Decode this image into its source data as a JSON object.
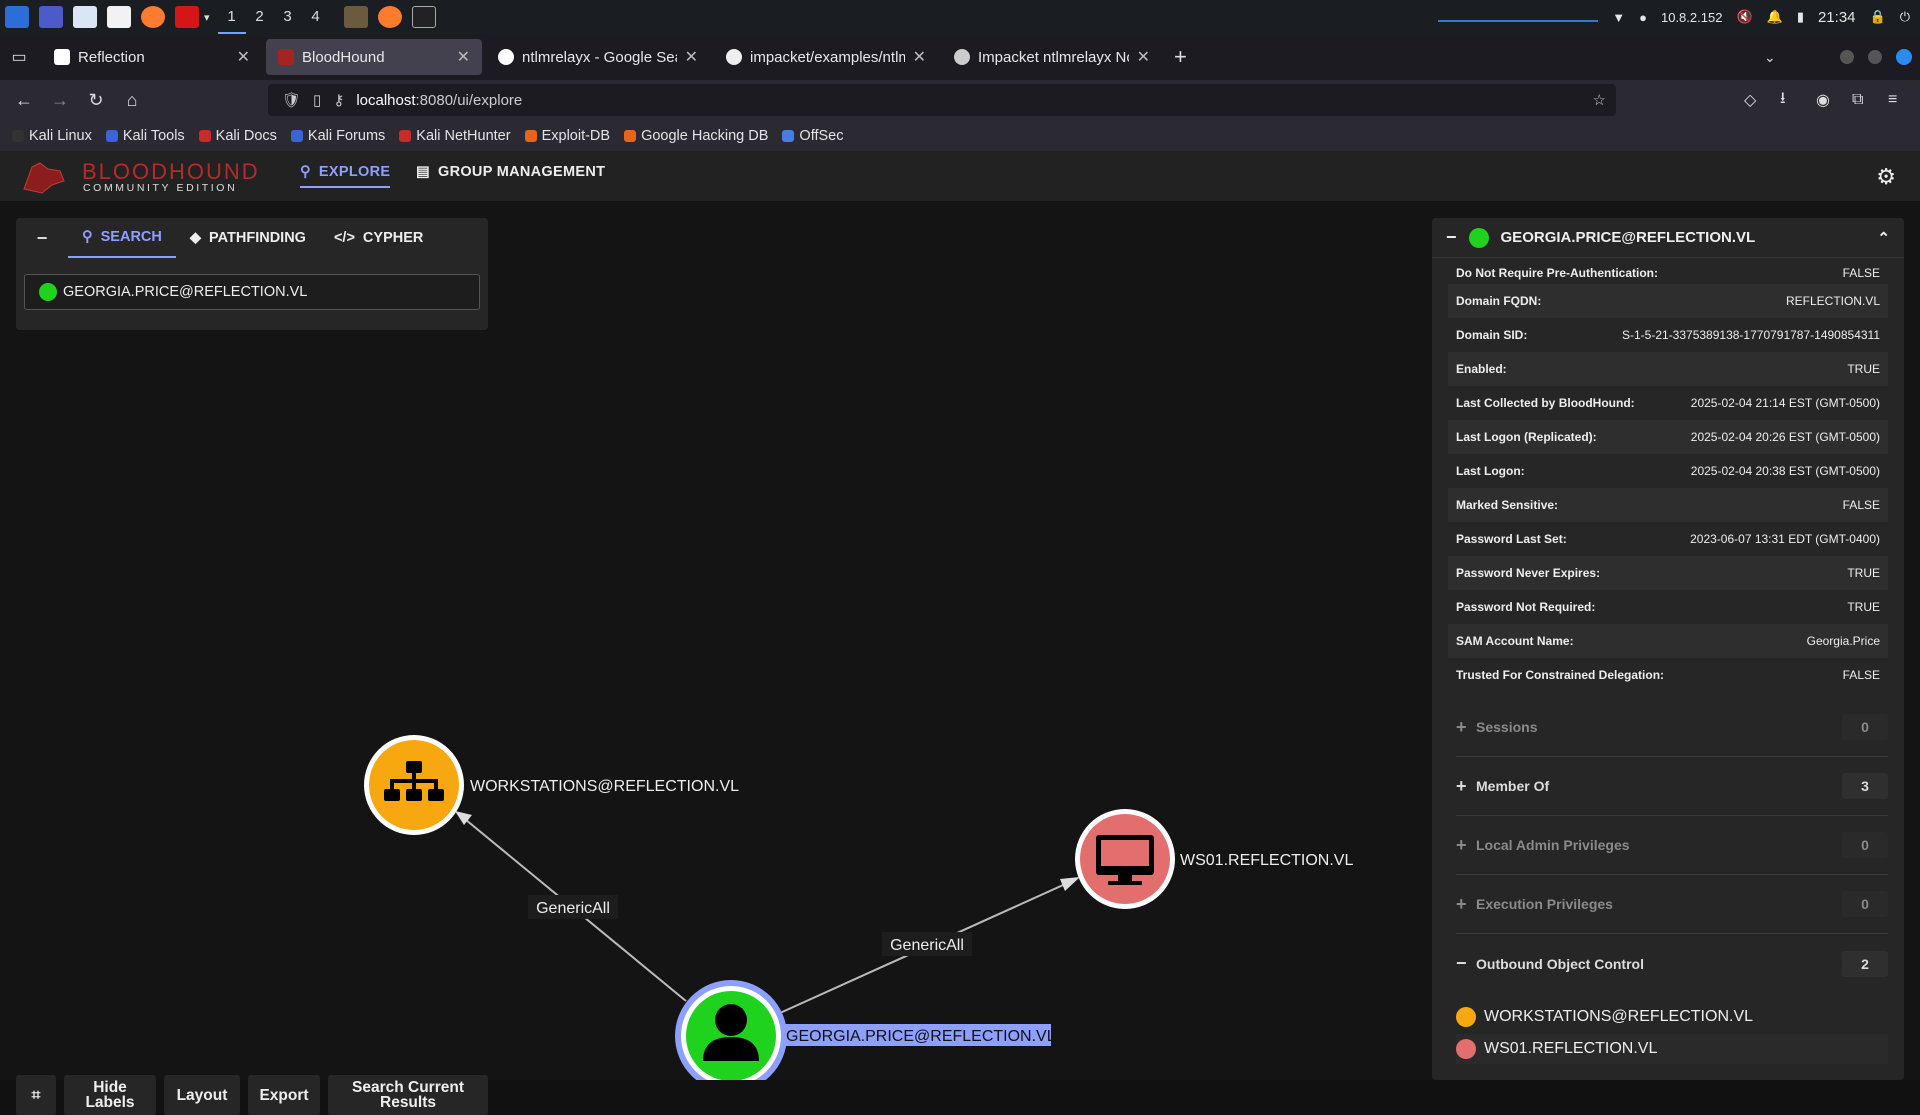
{
  "taskbar": {
    "workspaces": [
      "1",
      "2",
      "3",
      "4"
    ],
    "active_workspace": "1",
    "ip": "10.8.2.152",
    "time": "21:34"
  },
  "browser": {
    "tabs": [
      {
        "label": "Reflection",
        "active": false
      },
      {
        "label": "BloodHound",
        "active": true
      },
      {
        "label": "ntlmrelayx - Google Searc",
        "active": false
      },
      {
        "label": "impacket/examples/ntlmr",
        "active": false
      },
      {
        "label": "Impacket ntlmrelayx Not",
        "active": false
      }
    ],
    "url_host": "localhost",
    "url_rest": ":8080/ui/explore",
    "bookmarks": [
      "Kali Linux",
      "Kali Tools",
      "Kali Docs",
      "Kali Forums",
      "Kali NetHunter",
      "Exploit-DB",
      "Google Hacking DB",
      "OffSec"
    ]
  },
  "app": {
    "logo_main": "BLOODHOUND",
    "logo_sub": "COMMUNITY EDITION",
    "nav": {
      "explore": "EXPLORE",
      "group_management": "GROUP MANAGEMENT"
    },
    "search_tabs": {
      "search": "SEARCH",
      "pathfinding": "PATHFINDING",
      "cypher": "CYPHER"
    },
    "search_value": "GEORGIA.PRICE@REFLECTION.VL",
    "bottom_buttons": {
      "hide_labels": "Hide Labels",
      "layout": "Layout",
      "export": "Export",
      "search_results": "Search Current Results"
    }
  },
  "graph": {
    "nodes": {
      "workstations": "WORKSTATIONS@REFLECTION.VL",
      "ws01": "WS01.REFLECTION.VL",
      "georgia": "GEORGIA.PRICE@REFLECTION.VL"
    },
    "edges": {
      "to_workstations": "GenericAll",
      "to_ws01": "GenericAll"
    }
  },
  "panel": {
    "title": "GEORGIA.PRICE@REFLECTION.VL",
    "properties": [
      {
        "k": "Do Not Require Pre-Authentication:",
        "v": "FALSE"
      },
      {
        "k": "Domain FQDN:",
        "v": "REFLECTION.VL"
      },
      {
        "k": "Domain SID:",
        "v": "S-1-5-21-3375389138-1770791787-1490854311"
      },
      {
        "k": "Enabled:",
        "v": "TRUE"
      },
      {
        "k": "Last Collected by BloodHound:",
        "v": "2025-02-04 21:14 EST (GMT-0500)"
      },
      {
        "k": "Last Logon (Replicated):",
        "v": "2025-02-04 20:26 EST (GMT-0500)"
      },
      {
        "k": "Last Logon:",
        "v": "2025-02-04 20:38 EST (GMT-0500)"
      },
      {
        "k": "Marked Sensitive:",
        "v": "FALSE"
      },
      {
        "k": "Password Last Set:",
        "v": "2023-06-07 13:31 EDT (GMT-0400)"
      },
      {
        "k": "Password Never Expires:",
        "v": "TRUE"
      },
      {
        "k": "Password Not Required:",
        "v": "TRUE"
      },
      {
        "k": "SAM Account Name:",
        "v": "Georgia.Price"
      },
      {
        "k": "Trusted For Constrained Delegation:",
        "v": "FALSE"
      }
    ],
    "sections": [
      {
        "label": "Sessions",
        "count": "0",
        "expanded": false
      },
      {
        "label": "Member Of",
        "count": "3",
        "expanded": false
      },
      {
        "label": "Local Admin Privileges",
        "count": "0",
        "expanded": false
      },
      {
        "label": "Execution Privileges",
        "count": "0",
        "expanded": false
      },
      {
        "label": "Outbound Object Control",
        "count": "2",
        "expanded": true
      }
    ],
    "outbound": [
      "WORKSTATIONS@REFLECTION.VL",
      "WS01.REFLECTION.VL"
    ]
  },
  "colors": {
    "accent": "#8ea0ff",
    "group": "#f7a70f",
    "computer": "#e36e6e",
    "user": "#1ed21e"
  }
}
